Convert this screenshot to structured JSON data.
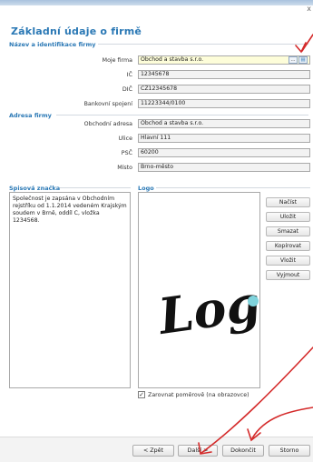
{
  "window": {
    "close_glyph": "x"
  },
  "page_title": "Základní údaje o firmě",
  "sections": {
    "identification": {
      "heading": "Název a identifikace firmy",
      "fields": [
        {
          "label": "Moje firma",
          "value": "Obchod a stavba s.r.o."
        },
        {
          "label": "IČ",
          "value": "12345678"
        },
        {
          "label": "DIČ",
          "value": "CZ12345678"
        },
        {
          "label": "Bankovní spojení",
          "value": "11223344/0100"
        }
      ],
      "buttons": {
        "more_label": "...",
        "detail_label": "▤"
      }
    },
    "address": {
      "heading": "Adresa firmy",
      "fields": [
        {
          "label": "Obchodní adresa",
          "value": "Obchod a stavba s.r.o."
        },
        {
          "label": "Ulice",
          "value": "Hlavní 111"
        },
        {
          "label": "PSČ",
          "value": "60200"
        },
        {
          "label": "Místo",
          "value": "Brno-město"
        }
      ]
    },
    "registry": {
      "heading": "Spisová značka",
      "text": "Společnost je zapsána v Obchodním rejstříku od 1.1.2014 vedeném Krajským soudem v Brně, oddíl C, vložka 1234568."
    },
    "logo": {
      "heading": "Logo",
      "image_text": "Logo",
      "dot_color": "#7fd3dc",
      "buttons": [
        "Načíst",
        "Uložit",
        "Smazat",
        "Kopírovat",
        "Vložit",
        "Vyjmout"
      ],
      "checkbox": {
        "label": "Zarovnat poměrově (na obrazovce)",
        "checked": true
      }
    }
  },
  "navigation": {
    "back": "< Zpět",
    "next": "Další >",
    "finish": "Dokončit",
    "cancel": "Storno"
  },
  "colors": {
    "accent": "#2a78b5",
    "annotation": "#d42a2a"
  },
  "annotations": {
    "arrow_icon": "hand-drawn-arrow-icon"
  }
}
